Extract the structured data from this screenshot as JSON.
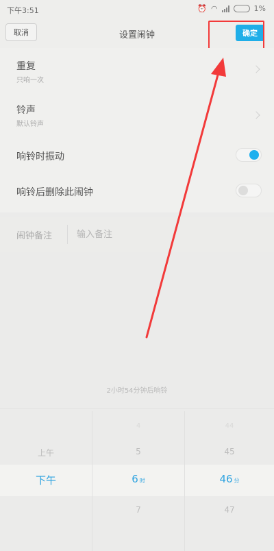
{
  "status_bar": {
    "time": "下午3:51",
    "battery": "1%"
  },
  "header": {
    "cancel_label": "取消",
    "title": "设置闹钟",
    "confirm_label": "确定"
  },
  "settings": {
    "repeat": {
      "label": "重复",
      "value": "只响一次"
    },
    "ringtone": {
      "label": "铃声",
      "value": "默认铃声"
    },
    "vibrate": {
      "label": "响铃时振动",
      "enabled": true
    },
    "delete_after": {
      "label": "响铃后删除此闹钟",
      "enabled": false
    }
  },
  "note": {
    "label": "闹钟备注",
    "placeholder": "输入备注"
  },
  "countdown_text": "2小时54分钟后响铃",
  "picker": {
    "ampm": {
      "above": "上午",
      "selected": "下午"
    },
    "hour": {
      "far_above": "4",
      "above": "5",
      "selected": "6",
      "unit": "时",
      "below": "7"
    },
    "minute": {
      "far_above": "44",
      "above": "45",
      "selected": "46",
      "unit": "分",
      "below": "47"
    }
  },
  "colors": {
    "accent": "#1faee8",
    "annotation": "#f23a3a"
  }
}
